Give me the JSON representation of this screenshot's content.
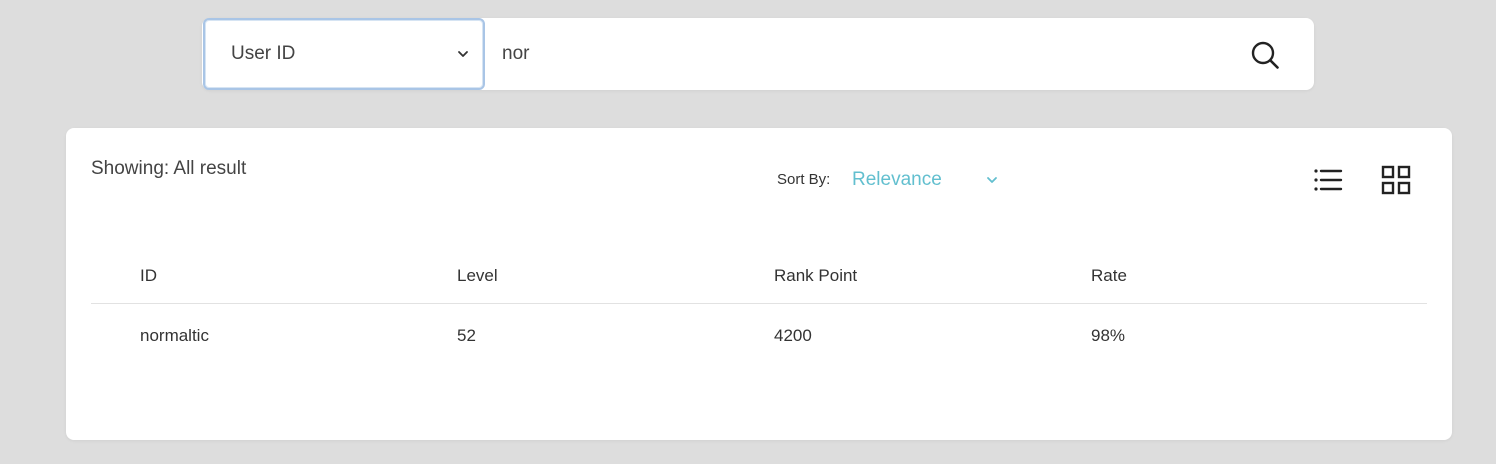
{
  "search": {
    "field_select_value": "User ID",
    "query_value": "nor"
  },
  "results": {
    "showing_text": "Showing: All result",
    "sort_label": "Sort By:",
    "sort_value": "Relevance",
    "accent_color": "#62bfcf"
  },
  "table": {
    "headers": [
      "ID",
      "Level",
      "Rank Point",
      "Rate"
    ],
    "rows": [
      [
        "normaltic",
        "52",
        "4200",
        "98%"
      ]
    ]
  },
  "icons": {
    "search": "search-icon",
    "list_view": "list-view-icon",
    "grid_view": "grid-view-icon",
    "dropdown": "chevron-down-icon"
  }
}
